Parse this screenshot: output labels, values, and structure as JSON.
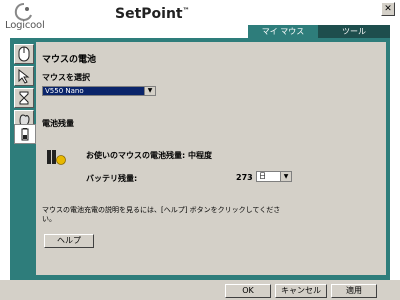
{
  "app": {
    "brand": "Logicool",
    "title": "SetPoint",
    "trademark": "™",
    "close_glyph": "✕"
  },
  "tabs": [
    {
      "label": "マイ マウス",
      "active": true
    },
    {
      "label": "ツール",
      "active": false
    }
  ],
  "sidebar": {
    "items": [
      {
        "icon": "mouse-buttons-icon",
        "glyph": "🖱"
      },
      {
        "icon": "pointer-icon",
        "glyph": "↖"
      },
      {
        "icon": "hourglass-icon",
        "glyph": "⌛"
      },
      {
        "icon": "hand-icon",
        "glyph": "✋"
      },
      {
        "icon": "battery-icon",
        "glyph": "▮"
      }
    ]
  },
  "panel": {
    "section_title": "マウスの電池",
    "select_mouse_label": "マウスを選択",
    "mouse_select_value": "V550 Nano",
    "battery_heading": "電池残量",
    "battery_status_label": "お使いのマウスの電池残量: 中程度",
    "battery_life_label": "バッテリ残量:",
    "battery_life_value": "273",
    "battery_unit_value": "日",
    "help_text": "マウスの電池充電の説明を見るには、[ヘルプ] ボタンをクリックしてください。",
    "help_button": "ヘルプ"
  },
  "footer": {
    "ok": "OK",
    "cancel": "キャンセル",
    "apply": "適用"
  },
  "colors": {
    "teal_active": "#2e7d7b",
    "teal_dark": "#1e4e4d",
    "select_highlight": "#0a246a",
    "battery_yellow": "#e8b800"
  }
}
